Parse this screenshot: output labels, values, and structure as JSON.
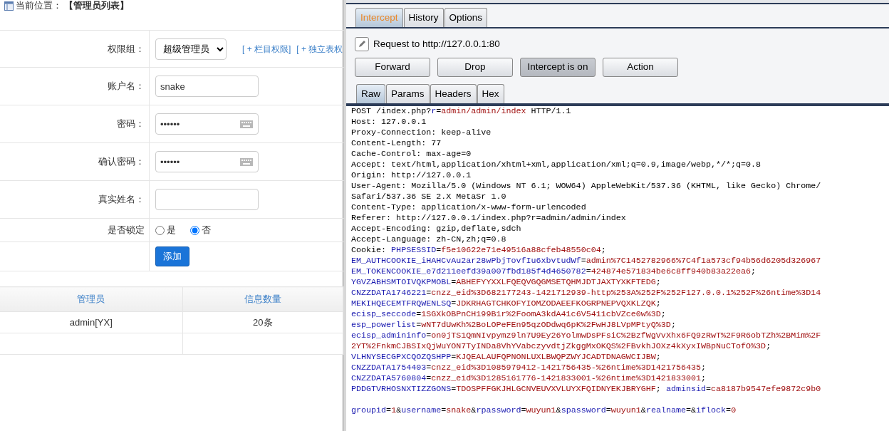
{
  "breadcrumb": {
    "label": "当前位置：",
    "value": "【管理员列表】"
  },
  "form": {
    "rows": [
      {
        "kind": "select",
        "label": "权限组：",
        "value": "超级管理员",
        "links": [
          "[ + 栏目权限]",
          "[ + 独立表权"
        ]
      },
      {
        "kind": "text",
        "label": "账户名：",
        "value": "snake"
      },
      {
        "kind": "password",
        "label": "密码：",
        "value": "••••••"
      },
      {
        "kind": "password",
        "label": "确认密码：",
        "value": "••••••"
      },
      {
        "kind": "text",
        "label": "真实姓名："
      },
      {
        "kind": "radio",
        "label": "是否锁定",
        "options": [
          {
            "label": "是",
            "selected": false
          },
          {
            "label": "否",
            "selected": true
          }
        ]
      },
      {
        "kind": "button",
        "value": "添加"
      }
    ]
  },
  "table": {
    "columns": [
      "管理员",
      "信息数量"
    ],
    "rows": [
      [
        "admin[YX]",
        "20条"
      ]
    ]
  },
  "proxy": {
    "tabs": [
      {
        "label": "Intercept",
        "selected": true
      },
      {
        "label": "History",
        "selected": false
      },
      {
        "label": "Options",
        "selected": false
      }
    ],
    "request_label": "Request to http://127.0.0.1:80",
    "buttons": [
      {
        "label": "Forward",
        "pressed": false
      },
      {
        "label": "Drop",
        "pressed": false
      },
      {
        "label": "Intercept is on",
        "pressed": true
      },
      {
        "label": "Action",
        "pressed": false
      }
    ],
    "message_tabs": [
      {
        "label": "Raw",
        "selected": true
      },
      {
        "label": "Params",
        "selected": false
      },
      {
        "label": "Headers",
        "selected": false
      },
      {
        "label": "Hex",
        "selected": false
      }
    ],
    "lines": [
      {
        "kind": "code",
        "tokens": [
          {
            "kind": "plain",
            "text": "POST /index.php?"
          },
          {
            "kind": "name",
            "text": "r"
          },
          {
            "kind": "plain",
            "text": "="
          },
          {
            "kind": "value",
            "text": "admin/admin/index"
          },
          {
            "kind": "plain",
            "text": " HTTP/1.1"
          }
        ]
      },
      {
        "kind": "code",
        "tokens": [
          {
            "kind": "plain",
            "text": "Host: 127.0.0.1"
          }
        ]
      },
      {
        "kind": "code",
        "tokens": [
          {
            "kind": "plain",
            "text": "Proxy-Connection: keep-alive"
          }
        ]
      },
      {
        "kind": "code",
        "tokens": [
          {
            "kind": "plain",
            "text": "Content-Length: 77"
          }
        ]
      },
      {
        "kind": "code",
        "tokens": [
          {
            "kind": "plain",
            "text": "Cache-Control: max-age=0"
          }
        ]
      },
      {
        "kind": "code",
        "tokens": [
          {
            "kind": "plain",
            "text": "Accept: text/html,application/xhtml+xml,application/xml;q=0.9,image/webp,*/*;q=0.8"
          }
        ]
      },
      {
        "kind": "code",
        "tokens": [
          {
            "kind": "plain",
            "text": "Origin: http://127.0.0.1"
          }
        ]
      },
      {
        "kind": "code",
        "tokens": [
          {
            "kind": "plain",
            "text": "User-Agent: Mozilla/5.0 (Windows NT 6.1; WOW64) AppleWebKit/537.36 (KHTML, like Gecko) Chrome/"
          }
        ]
      },
      {
        "kind": "code",
        "tokens": [
          {
            "kind": "plain",
            "text": "Safari/537.36 SE 2.X MetaSr 1.0"
          }
        ]
      },
      {
        "kind": "code",
        "tokens": [
          {
            "kind": "plain",
            "text": "Content-Type: application/x-www-form-urlencoded"
          }
        ]
      },
      {
        "kind": "code",
        "tokens": [
          {
            "kind": "plain",
            "text": "Referer: http://127.0.0.1/index.php?r=admin/admin/index"
          }
        ]
      },
      {
        "kind": "code",
        "tokens": [
          {
            "kind": "plain",
            "text": "Accept-Encoding: gzip,deflate,sdch"
          }
        ]
      },
      {
        "kind": "code",
        "tokens": [
          {
            "kind": "plain",
            "text": "Accept-Language: zh-CN,zh;q=0.8"
          }
        ]
      },
      {
        "kind": "code",
        "tokens": [
          {
            "kind": "plain",
            "text": "Cookie: "
          },
          {
            "kind": "name",
            "text": "PHPSESSID"
          },
          {
            "kind": "plain",
            "text": "="
          },
          {
            "kind": "value",
            "text": "f5e10622e71e49516a88cfeb48550c04"
          },
          {
            "kind": "plain",
            "text": ";"
          }
        ]
      },
      {
        "kind": "code",
        "tokens": [
          {
            "kind": "name",
            "text": "EM_AUTHCOOKIE_iHAHCvAu2ar28wPbjTovfIu6xbvtudWf"
          },
          {
            "kind": "plain",
            "text": "="
          },
          {
            "kind": "value",
            "text": "admin%7C1452782966%7C4f1a573cf94b56d6205d326967"
          }
        ]
      },
      {
        "kind": "code",
        "tokens": [
          {
            "kind": "name",
            "text": "EM_TOKENCOOKIE_e7d211eefd39a007fbd185f4d4650782"
          },
          {
            "kind": "plain",
            "text": "="
          },
          {
            "kind": "value",
            "text": "424874e571834be6c8ff940b83a22ea6"
          },
          {
            "kind": "plain",
            "text": ";"
          }
        ]
      },
      {
        "kind": "code",
        "tokens": [
          {
            "kind": "name",
            "text": "YGVZABHSMTOIVQKPMOBL"
          },
          {
            "kind": "plain",
            "text": "="
          },
          {
            "kind": "value",
            "text": "ABHEFYYXXLFQEQVGQGMSETQHMJDTJAXTYXKFTEDG"
          },
          {
            "kind": "plain",
            "text": ";"
          }
        ]
      },
      {
        "kind": "code",
        "tokens": [
          {
            "kind": "name",
            "text": "CNZZDATA1746221"
          },
          {
            "kind": "plain",
            "text": "="
          },
          {
            "kind": "value",
            "text": "cnzz_eid%3D682177243-1421712939-http%253A%252F%252F127.0.0.1%252F%26ntime%3D14"
          }
        ]
      },
      {
        "kind": "code",
        "tokens": [
          {
            "kind": "name",
            "text": "MEKIHQECEMTFRQWENLSQ"
          },
          {
            "kind": "plain",
            "text": "="
          },
          {
            "kind": "value",
            "text": "JDKRHAGTCHKOFYIOMZODAEEFKOGRPNEPVQXKLZQK"
          },
          {
            "kind": "plain",
            "text": ";"
          }
        ]
      },
      {
        "kind": "code",
        "tokens": [
          {
            "kind": "name",
            "text": "ecisp_seccode"
          },
          {
            "kind": "plain",
            "text": "="
          },
          {
            "kind": "value",
            "text": "1SGXkOBPnCH199B1r%2FoomA3kdA41c6V5411cbVZce0w%3D"
          },
          {
            "kind": "plain",
            "text": ";"
          }
        ]
      },
      {
        "kind": "code",
        "tokens": [
          {
            "kind": "name",
            "text": "esp_powerlist"
          },
          {
            "kind": "plain",
            "text": "="
          },
          {
            "kind": "value",
            "text": "wNT7dUwKh%2BoLOPeFEn95qzODdwq6pK%2FwHJ8LVpMPtyQ%3D"
          },
          {
            "kind": "plain",
            "text": ";"
          }
        ]
      },
      {
        "kind": "code",
        "tokens": [
          {
            "kind": "name",
            "text": "ecisp_admininfo"
          },
          {
            "kind": "plain",
            "text": "="
          },
          {
            "kind": "value",
            "text": "on0jTS1QmNIvpymz9ln7U9Ey26YolmwDsPFsiC%2BzfWgVvXhx6FQ9zRwT%2F9R6obTZh%2BMim%2F"
          }
        ]
      },
      {
        "kind": "code",
        "tokens": [
          {
            "kind": "value",
            "text": "2YT%2FnkmCJBSIxQjWuYON7TyINDa8VhYVabczyvdtjZkggMxOKQS%2FBvkhJOXz4kXyxIWBpNuCTofO%3D"
          },
          {
            "kind": "plain",
            "text": ";"
          }
        ]
      },
      {
        "kind": "code",
        "tokens": [
          {
            "kind": "name",
            "text": "VLHNYSECGPXCQOZQSHPP"
          },
          {
            "kind": "plain",
            "text": "="
          },
          {
            "kind": "value",
            "text": "KJQEALAUFQPNONLUXLBWQPZWYJCADTDNAGWCIJBW"
          },
          {
            "kind": "plain",
            "text": ";"
          }
        ]
      },
      {
        "kind": "code",
        "tokens": [
          {
            "kind": "name",
            "text": "CNZZDATA1754403"
          },
          {
            "kind": "plain",
            "text": "="
          },
          {
            "kind": "value",
            "text": "cnzz_eid%3D1085979412-1421756435-%26ntime%3D1421756435"
          },
          {
            "kind": "plain",
            "text": ";"
          }
        ]
      },
      {
        "kind": "code",
        "tokens": [
          {
            "kind": "name",
            "text": "CNZZDATA5760804"
          },
          {
            "kind": "plain",
            "text": "="
          },
          {
            "kind": "value",
            "text": "cnzz_eid%3D1285161776-1421833001-%26ntime%3D1421833001"
          },
          {
            "kind": "plain",
            "text": ";"
          }
        ]
      },
      {
        "kind": "code",
        "tokens": [
          {
            "kind": "name",
            "text": "PDDGTVRHOSNXTIZZGONS"
          },
          {
            "kind": "plain",
            "text": "="
          },
          {
            "kind": "value",
            "text": "TDOSPFFGKJHLGCNVEUVXVLUYXFQIDNYEKJBRYGHF"
          },
          {
            "kind": "plain",
            "text": "; "
          },
          {
            "kind": "name",
            "text": "adminsid"
          },
          {
            "kind": "plain",
            "text": "="
          },
          {
            "kind": "value",
            "text": "ca8187b9547efe9872c9b0"
          }
        ]
      },
      {
        "kind": "blank"
      },
      {
        "kind": "code",
        "tokens": [
          {
            "kind": "name",
            "text": "groupid"
          },
          {
            "kind": "plain",
            "text": "="
          },
          {
            "kind": "value",
            "text": "1"
          },
          {
            "kind": "plain",
            "text": "&"
          },
          {
            "kind": "name",
            "text": "username"
          },
          {
            "kind": "plain",
            "text": "="
          },
          {
            "kind": "value",
            "text": "snake"
          },
          {
            "kind": "plain",
            "text": "&"
          },
          {
            "kind": "name",
            "text": "rpassword"
          },
          {
            "kind": "plain",
            "text": "="
          },
          {
            "kind": "value",
            "text": "wuyun1"
          },
          {
            "kind": "plain",
            "text": "&"
          },
          {
            "kind": "name",
            "text": "spassword"
          },
          {
            "kind": "plain",
            "text": "="
          },
          {
            "kind": "value",
            "text": "wuyun1"
          },
          {
            "kind": "plain",
            "text": "&"
          },
          {
            "kind": "name",
            "text": "realname"
          },
          {
            "kind": "plain",
            "text": "="
          },
          {
            "kind": "plain",
            "text": "&"
          },
          {
            "kind": "name",
            "text": "iflock"
          },
          {
            "kind": "plain",
            "text": "="
          },
          {
            "kind": "value",
            "text": "0"
          }
        ]
      }
    ]
  }
}
